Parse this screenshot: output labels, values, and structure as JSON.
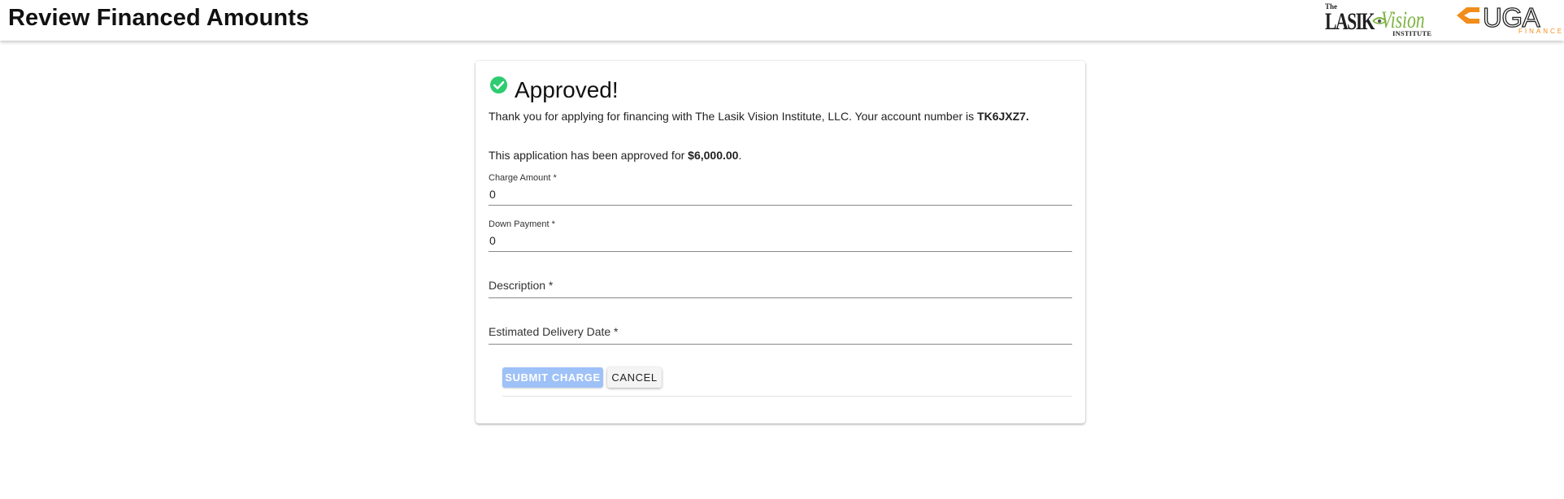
{
  "header": {
    "title": "Review Financed Amounts",
    "lasik_logo": {
      "the": "The",
      "word1": "LASIK",
      "word2": "Vision",
      "sub": "INSTITUTE",
      "icon": "eye-swoosh-icon"
    },
    "uga_logo": {
      "word": "UGA",
      "sub": "FINANCE",
      "icon": "uga-mark-icon",
      "accent": "#f28c1a"
    }
  },
  "card": {
    "status_icon": "check-circle-icon",
    "status_color": "#2ecc71",
    "title": "Approved!",
    "intro_text": "Thank you for applying for financing with The Lasik Vision Institute, LLC. Your account number is ",
    "account_number": "TK6JXZ7.",
    "approved_text": "This application has been approved for ",
    "approved_amount": "$6,000.00",
    "approved_suffix": ".",
    "fields": {
      "charge_amount": {
        "label": "Charge Amount *",
        "value": "0"
      },
      "down_payment": {
        "label": "Down Payment *",
        "value": "0"
      },
      "description": {
        "label": "Description *",
        "value": ""
      },
      "delivery_date": {
        "label": "Estimated Delivery Date *",
        "value": ""
      }
    },
    "buttons": {
      "submit": "SUBMIT CHARGE",
      "cancel": "CANCEL"
    }
  }
}
